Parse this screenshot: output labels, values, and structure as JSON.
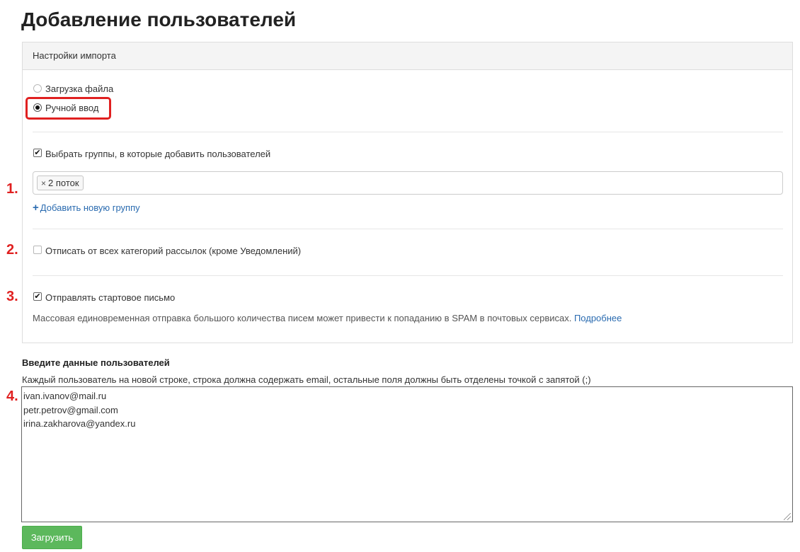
{
  "page": {
    "title": "Добавление пользователей"
  },
  "import_panel": {
    "heading": "Настройки импорта",
    "source_options": [
      {
        "label": "Загрузка файла",
        "checked": false
      },
      {
        "label": "Ручной ввод",
        "checked": true
      }
    ],
    "select_groups": {
      "label": "Выбрать группы, в которые добавить пользователей",
      "checked": true
    },
    "groups": [
      {
        "remove": "×",
        "label": "2 поток"
      }
    ],
    "add_group": {
      "icon": "plus-icon",
      "label": "Добавить новую группу"
    },
    "unsubscribe": {
      "label": "Отписать от всех категорий рассылок (кроме Уведомлений)",
      "checked": false
    },
    "send_welcome": {
      "label": "Отправлять стартовое письмо",
      "checked": true
    },
    "spam_note": "Массовая единовременная отправка большого количества писем может привести к попаданию в SPAM в почтовых сервисах.",
    "more_link": "Подробнее"
  },
  "markers": [
    "1.",
    "2.",
    "3.",
    "4."
  ],
  "user_input": {
    "heading": "Введите данные пользователей",
    "description": "Каждый пользователь на новой строке, строка должна содержать email, остальные поля должны быть отделены точкой с запятой (;)",
    "lines": [
      "ivan.ivanov@mail.ru",
      "petr.petrov@gmail.com",
      "irina.zakharova@yandex.ru"
    ]
  },
  "submit_label": "Загрузить",
  "colors": {
    "annotation_red": "#e02020",
    "button_green": "#5cb85c",
    "link_blue": "#2a6bb0"
  }
}
